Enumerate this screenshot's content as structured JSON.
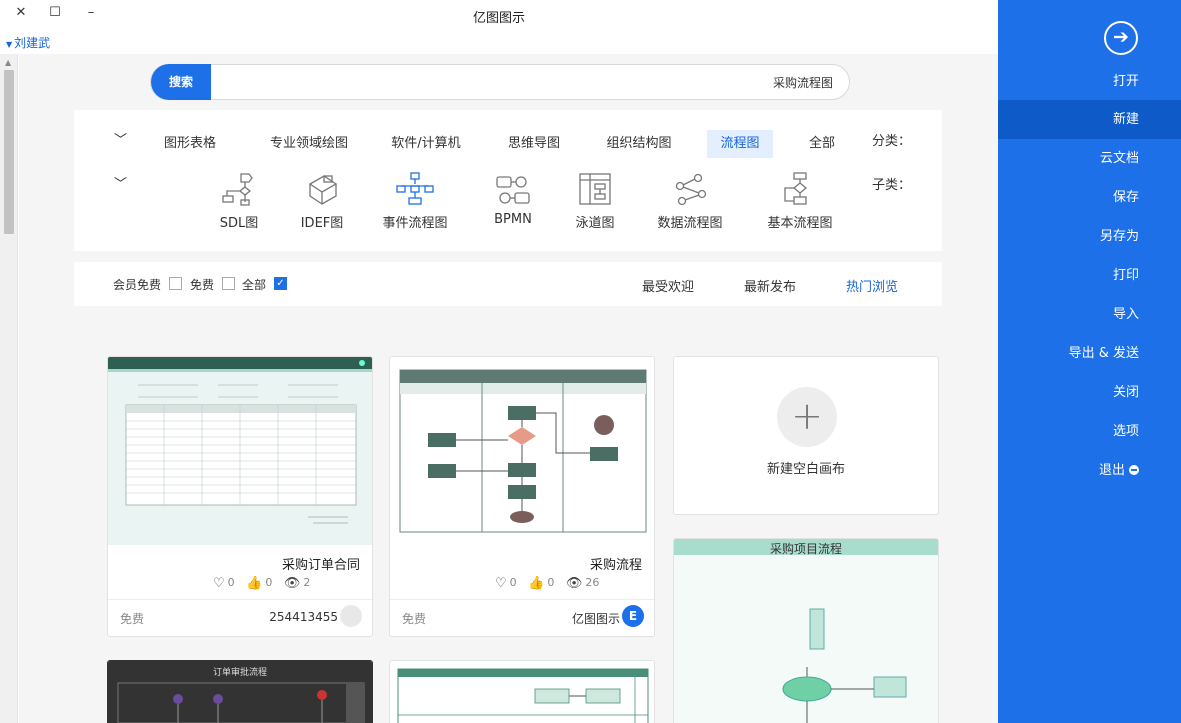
{
  "window": {
    "title": "亿图图示",
    "minimize": "–",
    "maximize": "☐",
    "close": "✕"
  },
  "user": {
    "name": "刘建武"
  },
  "sidebar": {
    "items": [
      {
        "label": "打开"
      },
      {
        "label": "新建",
        "active": true
      },
      {
        "label": "云文档"
      },
      {
        "label": "保存"
      },
      {
        "label": "另存为"
      },
      {
        "label": "打印"
      },
      {
        "label": "导入"
      },
      {
        "label": "导出 & 发送"
      },
      {
        "label": "关闭"
      },
      {
        "label": "选项"
      },
      {
        "label": "退出"
      }
    ]
  },
  "search": {
    "button": "搜索",
    "value": "采购流程图"
  },
  "categories": {
    "label": "分类：",
    "items": [
      "全部",
      "流程图",
      "组织结构图",
      "思维导图",
      "软件/计算机",
      "专业领域绘图",
      "图形表格"
    ],
    "selected": "流程图"
  },
  "subcategories": {
    "label": "子类：",
    "items": [
      "基本流程图",
      "数据流程图",
      "泳道图",
      "BPMN",
      "事件流程图",
      "IDEF图",
      "SDL图"
    ],
    "selected": "事件流程图"
  },
  "sort": {
    "items": [
      "热门浏览",
      "最新发布",
      "最受欢迎"
    ],
    "selected": "热门浏览"
  },
  "filters": {
    "all": "全部",
    "free": "免费",
    "member": "会员免费"
  },
  "new_blank": {
    "label": "新建空白画布"
  },
  "cards": [
    {
      "name": "采购流程",
      "views": "26",
      "likes": "0",
      "favorites": "0",
      "author": "亿图图示",
      "price": "免费"
    },
    {
      "name": "采购订单合同",
      "views": "2",
      "likes": "0",
      "favorites": "0",
      "author": "254413455",
      "price": "免费"
    },
    {
      "name": "采购项目流程"
    },
    {
      "name": "订单审批流程"
    }
  ],
  "colors": {
    "accent": "#1e70e8",
    "sidebar": "#1e70e8",
    "sidebar_active": "#0d5ac8",
    "selected_bg": "#e3efff"
  }
}
